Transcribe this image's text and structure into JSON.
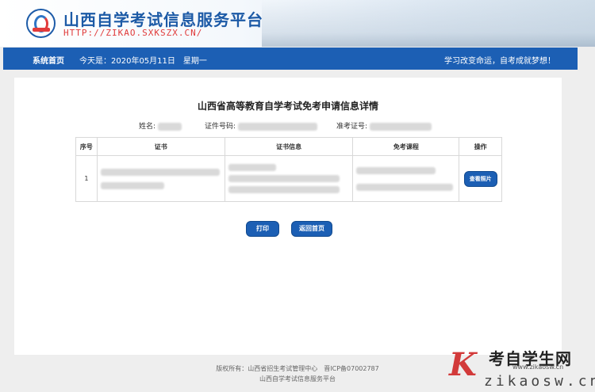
{
  "header": {
    "site_title": "山西自学考试信息服务平台",
    "site_url": "HTTP://ZIKAO.SXKSZX.CN/"
  },
  "navbar": {
    "home": "系统首页",
    "date": "今天是：2020年05月11日　星期一",
    "slogan": "学习改变命运，自考成就梦想！"
  },
  "main": {
    "title": "山西省高等教育自学考试免考申请信息详情",
    "name_label": "姓名:",
    "id_label": "证件号码:",
    "exam_id_label": "准考证号:",
    "table": {
      "headers": [
        "序号",
        "证书",
        "证书信息",
        "免考课程",
        "操作"
      ],
      "rows": [
        {
          "index": "1",
          "action": "查看照片"
        }
      ]
    },
    "print_button": "打印",
    "back_button": "返回首页"
  },
  "footer": {
    "line1": "版权所有：山西省招生考试管理中心　晋ICP备07002787",
    "line2": "山西自学考试信息服务平台"
  },
  "watermark": {
    "brand": "考自学生网",
    "url": "www.zikaosw.cn",
    "domain": "zikaosw.cn"
  },
  "colors": {
    "nav_blue": "#1c5fb4",
    "title_blue": "#1c5aa6",
    "url_red": "#e03a3a"
  }
}
